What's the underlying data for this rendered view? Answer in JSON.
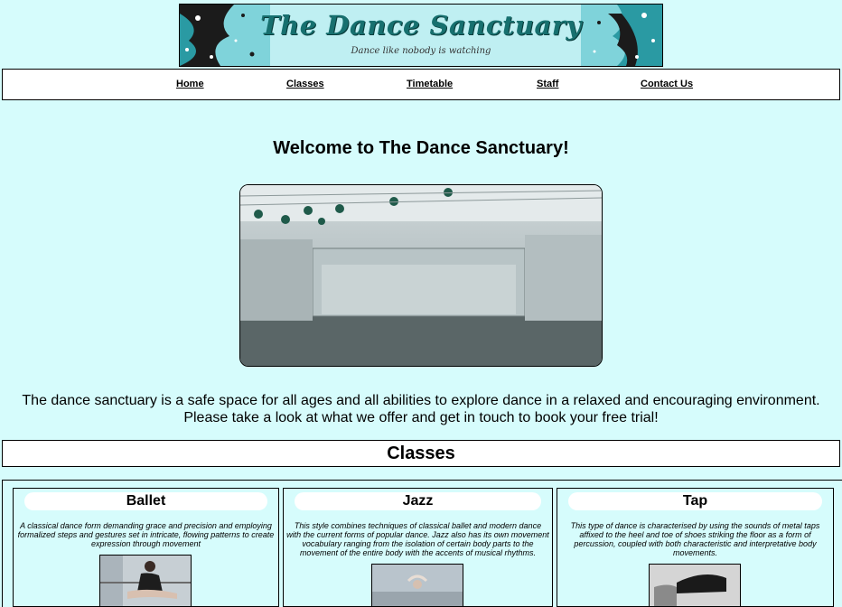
{
  "banner": {
    "title": "The Dance Sanctuary",
    "tagline": "Dance like nobody is watching"
  },
  "nav": {
    "items": [
      {
        "label": "Home"
      },
      {
        "label": "Classes"
      },
      {
        "label": "Timetable"
      },
      {
        "label": "Staff"
      },
      {
        "label": "Contact Us"
      }
    ]
  },
  "main": {
    "heading": "Welcome to The Dance Sanctuary!",
    "intro_line1": "The dance sanctuary is a safe space for all ages and all abilities to explore dance in a relaxed and encouraging environment.",
    "intro_line2": "Please take a look at what we offer and get in touch to book your free trial!"
  },
  "classes": {
    "heading": "Classes",
    "cards": [
      {
        "title": "Ballet",
        "description": "A classical dance form demanding grace and precision and employing formalized steps and gestures set in intricate, flowing patterns to create expression through movement"
      },
      {
        "title": "Jazz",
        "description": "This style combines techniques of classical ballet and modern dance with the current forms of popular dance. Jazz also has its own movement vocabulary ranging from the isolation of certain body parts to the movement of the entire body with the accents of musical rhythms."
      },
      {
        "title": "Tap",
        "description": "This type of dance is characterised by using the sounds of metal taps affixed to the heel and toe of shoes striking the floor as a form of percussion, coupled with both characteristic and interpretative body movements."
      }
    ]
  },
  "colors": {
    "page_background": "#d6fcfc",
    "banner_teal": "#17706f"
  }
}
